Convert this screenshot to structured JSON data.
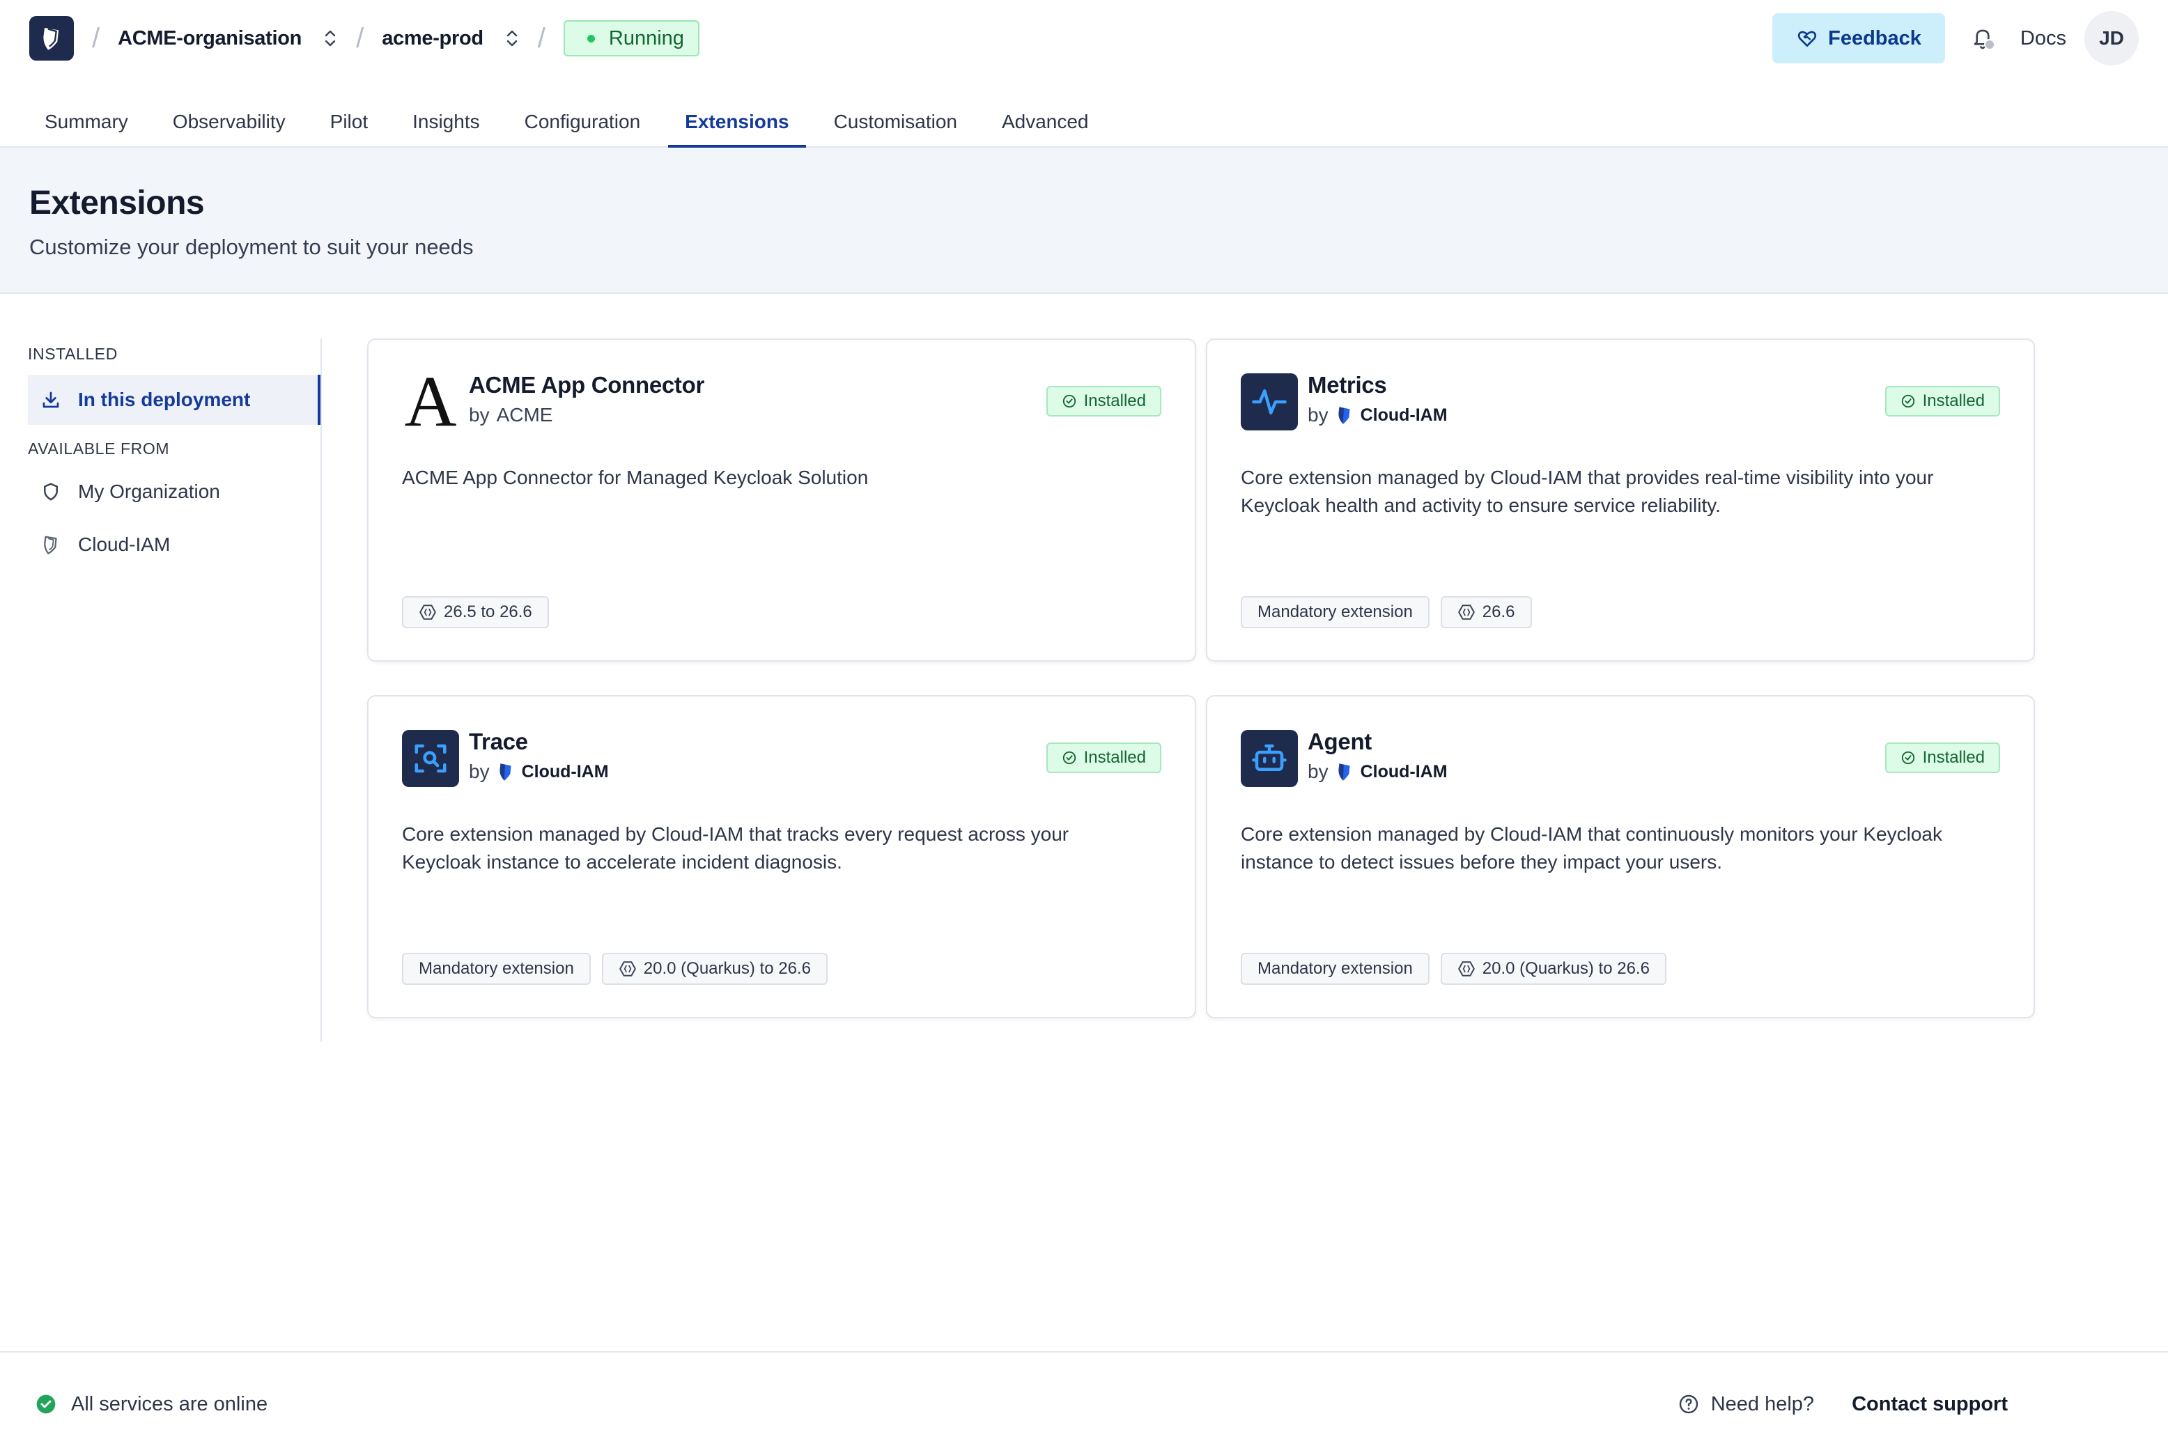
{
  "topbar": {
    "organisation": "ACME-organisation",
    "deployment": "acme-prod",
    "status": "Running",
    "feedback_label": "Feedback",
    "docs_label": "Docs",
    "avatar_initials": "JD"
  },
  "tabs": [
    {
      "label": "Summary"
    },
    {
      "label": "Observability"
    },
    {
      "label": "Pilot"
    },
    {
      "label": "Insights"
    },
    {
      "label": "Configuration"
    },
    {
      "label": "Extensions",
      "active": true
    },
    {
      "label": "Customisation"
    },
    {
      "label": "Advanced"
    }
  ],
  "header": {
    "title": "Extensions",
    "subtitle": "Customize your deployment to suit your needs"
  },
  "sidebar": {
    "installed_heading": "INSTALLED",
    "installed_item": "In this deployment",
    "available_heading": "AVAILABLE FROM",
    "available_items": [
      {
        "label": "My Organization",
        "icon": "shield-icon"
      },
      {
        "label": "Cloud-IAM",
        "icon": "cloud-iam-logo-icon"
      }
    ]
  },
  "cards": [
    {
      "title": "ACME App Connector",
      "by_prefix": "by",
      "by": "ACME",
      "status": "Installed",
      "description": "ACME App Connector for Managed Keycloak Solution",
      "mandatory": "",
      "versions": "26.5 to 26.6",
      "icon": "acme-logo-icon"
    },
    {
      "title": "Metrics",
      "by_prefix": "by",
      "by": "Cloud-IAM",
      "status": "Installed",
      "description": "Core extension managed by Cloud-IAM that provides real-time visibility into your Keycloak health and activity to ensure service reliability.",
      "mandatory": "Mandatory extension",
      "versions": "26.6",
      "icon": "activity-pulse-icon"
    },
    {
      "title": "Trace",
      "by_prefix": "by",
      "by": "Cloud-IAM",
      "status": "Installed",
      "description": "Core extension managed by Cloud-IAM that tracks every request across your Keycloak instance to accelerate incident diagnosis.",
      "mandatory": "Mandatory extension",
      "versions": "20.0 (Quarkus) to 26.6",
      "icon": "scan-search-icon"
    },
    {
      "title": "Agent",
      "by_prefix": "by",
      "by": "Cloud-IAM",
      "status": "Installed",
      "description": "Core extension managed by Cloud-IAM that continuously monitors your Keycloak instance to detect issues before they impact your users.",
      "mandatory": "Mandatory extension",
      "versions": "20.0 (Quarkus) to 26.6",
      "icon": "bot-icon"
    }
  ],
  "footer": {
    "status": "All services are online",
    "help_label": "Need help?",
    "contact_label": "Contact support"
  },
  "colors": {
    "accent": "#153a9c",
    "navy": "#1f2b4d",
    "success_bg": "#dcfce7",
    "success_text": "#166534",
    "feedback_bg": "#cdeefb"
  }
}
